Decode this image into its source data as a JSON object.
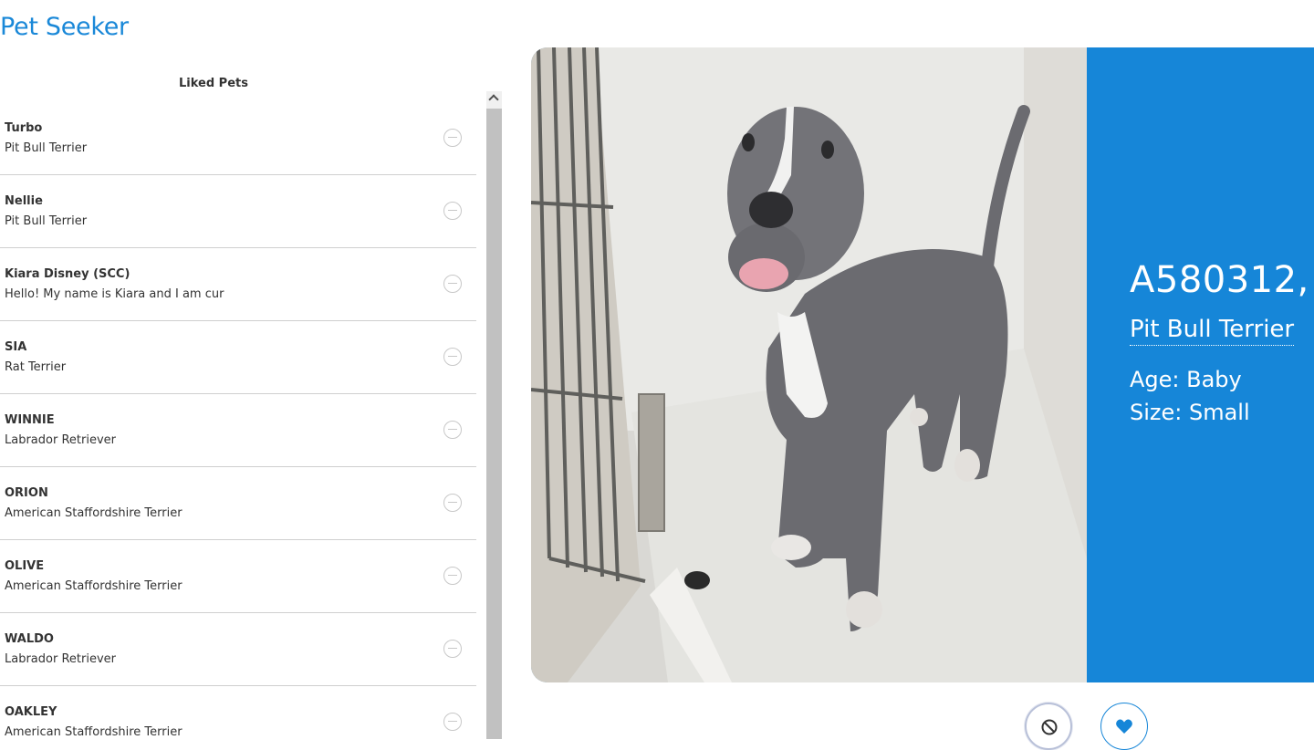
{
  "app": {
    "title": "Pet Seeker"
  },
  "liked": {
    "heading": "Liked Pets",
    "items": [
      {
        "name": "Turbo",
        "description": "Pit Bull Terrier"
      },
      {
        "name": "Nellie",
        "description": "Pit Bull Terrier"
      },
      {
        "name": "Kiara Disney (SCC)",
        "description": "Hello! My name is Kiara and I am cur"
      },
      {
        "name": "SIA",
        "description": "Rat Terrier"
      },
      {
        "name": "WINNIE",
        "description": "Labrador Retriever"
      },
      {
        "name": "ORION",
        "description": "American Staffordshire Terrier"
      },
      {
        "name": "OLIVE",
        "description": "American Staffordshire Terrier"
      },
      {
        "name": "WALDO",
        "description": "Labrador Retriever"
      },
      {
        "name": "OAKLEY",
        "description": "American Staffordshire Terrier"
      }
    ]
  },
  "current_pet": {
    "id": "A580312, ",
    "breed": "Pit Bull Terrier",
    "age": "Age: Baby",
    "size": "Size: Small"
  },
  "actions": {
    "reject_icon": "ban-icon",
    "like_icon": "heart-icon"
  },
  "colors": {
    "accent": "#1686d8",
    "title": "#1a88d8"
  }
}
